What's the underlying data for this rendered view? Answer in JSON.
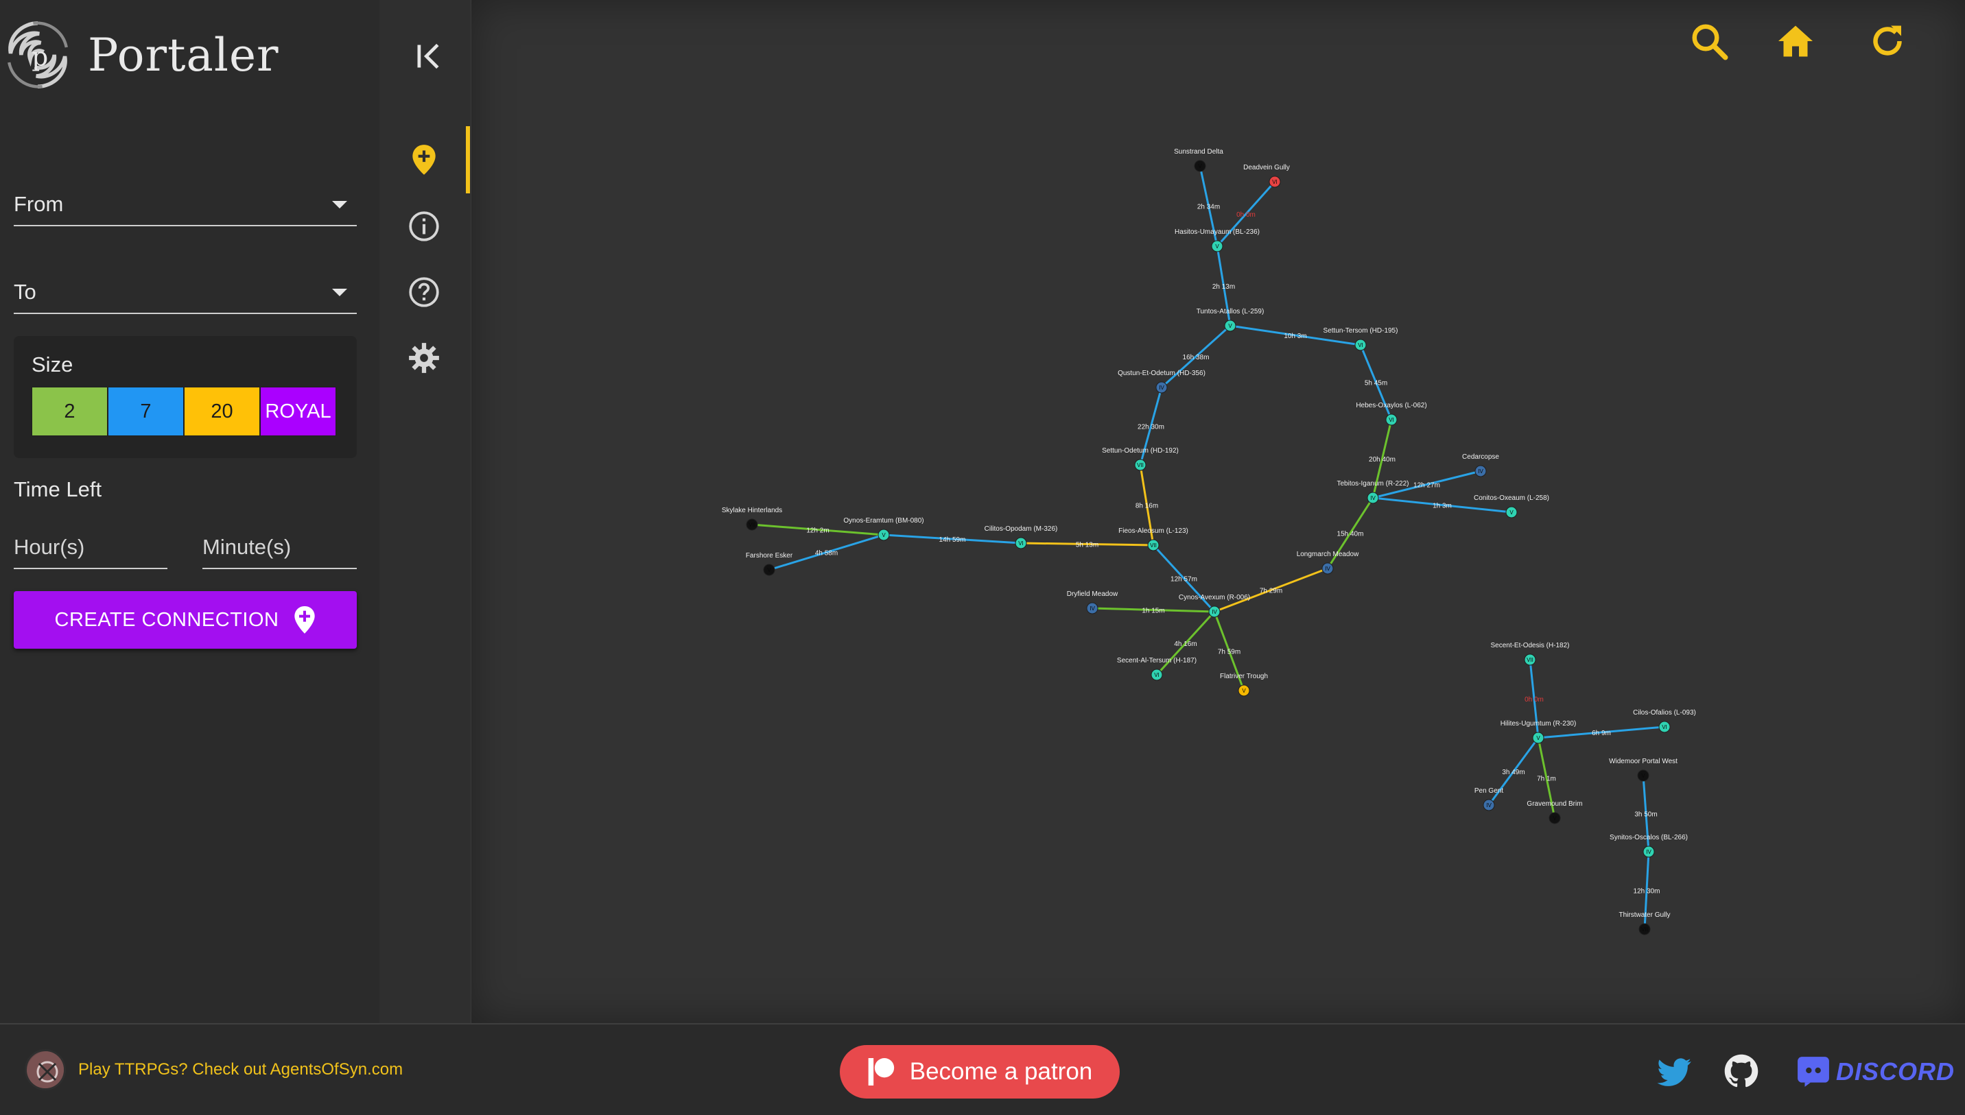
{
  "app": {
    "title": "Portaler"
  },
  "sidebar": {
    "from_label": "From",
    "to_label": "To",
    "size": {
      "title": "Size",
      "options": [
        {
          "label": "2",
          "color": "#8bc34a"
        },
        {
          "label": "7",
          "color": "#2196f3"
        },
        {
          "label": "20",
          "color": "#ffc107"
        },
        {
          "label": "ROYAL",
          "color": "#aa00ff"
        }
      ]
    },
    "time_left": {
      "title": "Time Left",
      "hours_label": "Hour(s)",
      "minutes_label": "Minute(s)"
    },
    "create_button": "CREATE CONNECTION"
  },
  "rail": {
    "items": [
      {
        "icon": "map-pin-plus-icon",
        "active": true
      },
      {
        "icon": "info-icon",
        "active": false
      },
      {
        "icon": "help-icon",
        "active": false
      },
      {
        "icon": "gear-icon",
        "active": false
      }
    ]
  },
  "toolbar": {
    "icons": [
      "search-icon",
      "home-icon",
      "refresh-icon"
    ],
    "accent": "#f3c21a"
  },
  "footer": {
    "promo_text": "Play TTRPGs? Check out AgentsOfSyn.com",
    "patron_label": "Become a patron",
    "discord_label": "DISCORD"
  },
  "graph": {
    "colors": {
      "blue": "#29a3e6",
      "green": "#6cc22d",
      "yellow": "#f3c21a",
      "node_teal": "#2fd3b2",
      "node_blue": "#3b6ea8",
      "node_black": "#111111",
      "node_red": "#e84343",
      "node_yellow": "#f5b800"
    },
    "nodes": [
      {
        "id": "sunstrand",
        "label": "Sunstrand Delta",
        "tier": "V",
        "kind": "black"
      },
      {
        "id": "deadvein",
        "label": "Deadvein Gully",
        "tier": "VI",
        "kind": "red"
      },
      {
        "id": "hasitos",
        "label": "Hasitos-Umayaum (BL-236)",
        "tier": "V",
        "kind": "teal"
      },
      {
        "id": "tuntos",
        "label": "Tuntos-Atallos (L-259)",
        "tier": "V",
        "kind": "teal"
      },
      {
        "id": "settun_tersom",
        "label": "Settun-Tersom (HD-195)",
        "tier": "VI",
        "kind": "teal"
      },
      {
        "id": "qustun",
        "label": "Qustun-Et-Odetum (HD-356)",
        "tier": "IV",
        "kind": "blue"
      },
      {
        "id": "hebes",
        "label": "Hebes-Oxaylos (L-062)",
        "tier": "VI",
        "kind": "teal"
      },
      {
        "id": "settun_odetum",
        "label": "Settun-Odetum (HD-192)",
        "tier": "VII",
        "kind": "teal"
      },
      {
        "id": "cedarcopse",
        "label": "Cedarcopse",
        "tier": "IV",
        "kind": "blue"
      },
      {
        "id": "tebitos",
        "label": "Tebitos-Iganum (R-222)",
        "tier": "IV",
        "kind": "teal"
      },
      {
        "id": "conitos",
        "label": "Conitos-Oxeaum (L-258)",
        "tier": "V",
        "kind": "teal"
      },
      {
        "id": "skylake",
        "label": "Skylake Hinterlands",
        "tier": "VII",
        "kind": "black"
      },
      {
        "id": "oynos_eram",
        "label": "Oynos-Eramtum (BM-080)",
        "tier": "V",
        "kind": "teal"
      },
      {
        "id": "cilitos",
        "label": "Cilitos-Opodam (M-326)",
        "tier": "VI",
        "kind": "teal"
      },
      {
        "id": "fieos",
        "label": "Fieos-Aleosum (L-123)",
        "tier": "VII",
        "kind": "teal"
      },
      {
        "id": "farshore",
        "label": "Farshore Esker",
        "tier": "V",
        "kind": "black"
      },
      {
        "id": "longmarch",
        "label": "Longmarch Meadow",
        "tier": "IV",
        "kind": "blue"
      },
      {
        "id": "dryfield",
        "label": "Dryfield Meadow",
        "tier": "IV",
        "kind": "blue"
      },
      {
        "id": "cynos",
        "label": "Cynos-Avexum (R-006)",
        "tier": "IV",
        "kind": "teal"
      },
      {
        "id": "secent_al",
        "label": "Secent-Al-Tersum (H-187)",
        "tier": "VI",
        "kind": "teal"
      },
      {
        "id": "flatriver",
        "label": "Flatriver Trough",
        "tier": "V",
        "kind": "yellow"
      },
      {
        "id": "secent_et",
        "label": "Secent-Et-Odesis (H-182)",
        "tier": "VII",
        "kind": "teal"
      },
      {
        "id": "cilos",
        "label": "Cilos-Ofalios (L-093)",
        "tier": "VI",
        "kind": "teal"
      },
      {
        "id": "hilites",
        "label": "Hilites-Ugumtum (R-230)",
        "tier": "V",
        "kind": "teal"
      },
      {
        "id": "widemoor",
        "label": "Widemoor Portal West",
        "tier": "V",
        "kind": "black"
      },
      {
        "id": "pen_gent",
        "label": "Pen Gent",
        "tier": "IV",
        "kind": "blue"
      },
      {
        "id": "gravemound",
        "label": "Gravemound Brim",
        "tier": "V",
        "kind": "black"
      },
      {
        "id": "synitos",
        "label": "Synitos-Oscalos (BL-266)",
        "tier": "IV",
        "kind": "teal"
      },
      {
        "id": "thirstwater",
        "label": "Thirstwater Gully",
        "tier": "VII",
        "kind": "black"
      }
    ],
    "edges": [
      {
        "a": "sunstrand",
        "b": "hasitos",
        "time": "2h 34m",
        "color": "blue"
      },
      {
        "a": "deadvein",
        "b": "hasitos",
        "time": "0h 0m",
        "color": "blue",
        "expired": true
      },
      {
        "a": "hasitos",
        "b": "tuntos",
        "time": "2h 13m",
        "color": "blue"
      },
      {
        "a": "tuntos",
        "b": "settun_tersom",
        "time": "10h 3m",
        "color": "blue"
      },
      {
        "a": "tuntos",
        "b": "qustun",
        "time": "16h 38m",
        "color": "blue"
      },
      {
        "a": "settun_tersom",
        "b": "hebes",
        "time": "5h 45m",
        "color": "blue"
      },
      {
        "a": "qustun",
        "b": "settun_odetum",
        "time": "22h 30m",
        "color": "blue"
      },
      {
        "a": "hebes",
        "b": "tebitos",
        "time": "20h 40m",
        "color": "green"
      },
      {
        "a": "tebitos",
        "b": "cedarcopse",
        "time": "12h 27m",
        "color": "blue"
      },
      {
        "a": "tebitos",
        "b": "conitos",
        "time": "1h 3m",
        "color": "blue"
      },
      {
        "a": "settun_odetum",
        "b": "fieos",
        "time": "8h 16m",
        "color": "yellow"
      },
      {
        "a": "tebitos",
        "b": "longmarch",
        "time": "15h 40m",
        "color": "green"
      },
      {
        "a": "skylake",
        "b": "oynos_eram",
        "time": "12h 2m",
        "color": "green"
      },
      {
        "a": "farshore",
        "b": "oynos_eram",
        "time": "4h 58m",
        "color": "blue"
      },
      {
        "a": "oynos_eram",
        "b": "cilitos",
        "time": "14h 59m",
        "color": "blue"
      },
      {
        "a": "cilitos",
        "b": "fieos",
        "time": "5h 13m",
        "color": "yellow"
      },
      {
        "a": "fieos",
        "b": "cynos",
        "time": "12h 57m",
        "color": "blue"
      },
      {
        "a": "longmarch",
        "b": "cynos",
        "time": "7h 29m",
        "color": "yellow"
      },
      {
        "a": "dryfield",
        "b": "cynos",
        "time": "1h 15m",
        "color": "green"
      },
      {
        "a": "cynos",
        "b": "secent_al",
        "time": "4h 16m",
        "color": "green"
      },
      {
        "a": "cynos",
        "b": "flatriver",
        "time": "7h 59m",
        "color": "green"
      },
      {
        "a": "secent_et",
        "b": "hilites",
        "time": "0h 0m",
        "color": "blue",
        "expired": true
      },
      {
        "a": "hilites",
        "b": "cilos",
        "time": "6h 9m",
        "color": "blue"
      },
      {
        "a": "hilites",
        "b": "pen_gent",
        "time": "3h 49m",
        "color": "blue"
      },
      {
        "a": "hilites",
        "b": "gravemound",
        "time": "7h 1m",
        "color": "green"
      },
      {
        "a": "widemoor",
        "b": "synitos",
        "time": "3h 50m",
        "color": "blue"
      },
      {
        "a": "synitos",
        "b": "thirstwater",
        "time": "12h 30m",
        "color": "blue"
      }
    ]
  }
}
